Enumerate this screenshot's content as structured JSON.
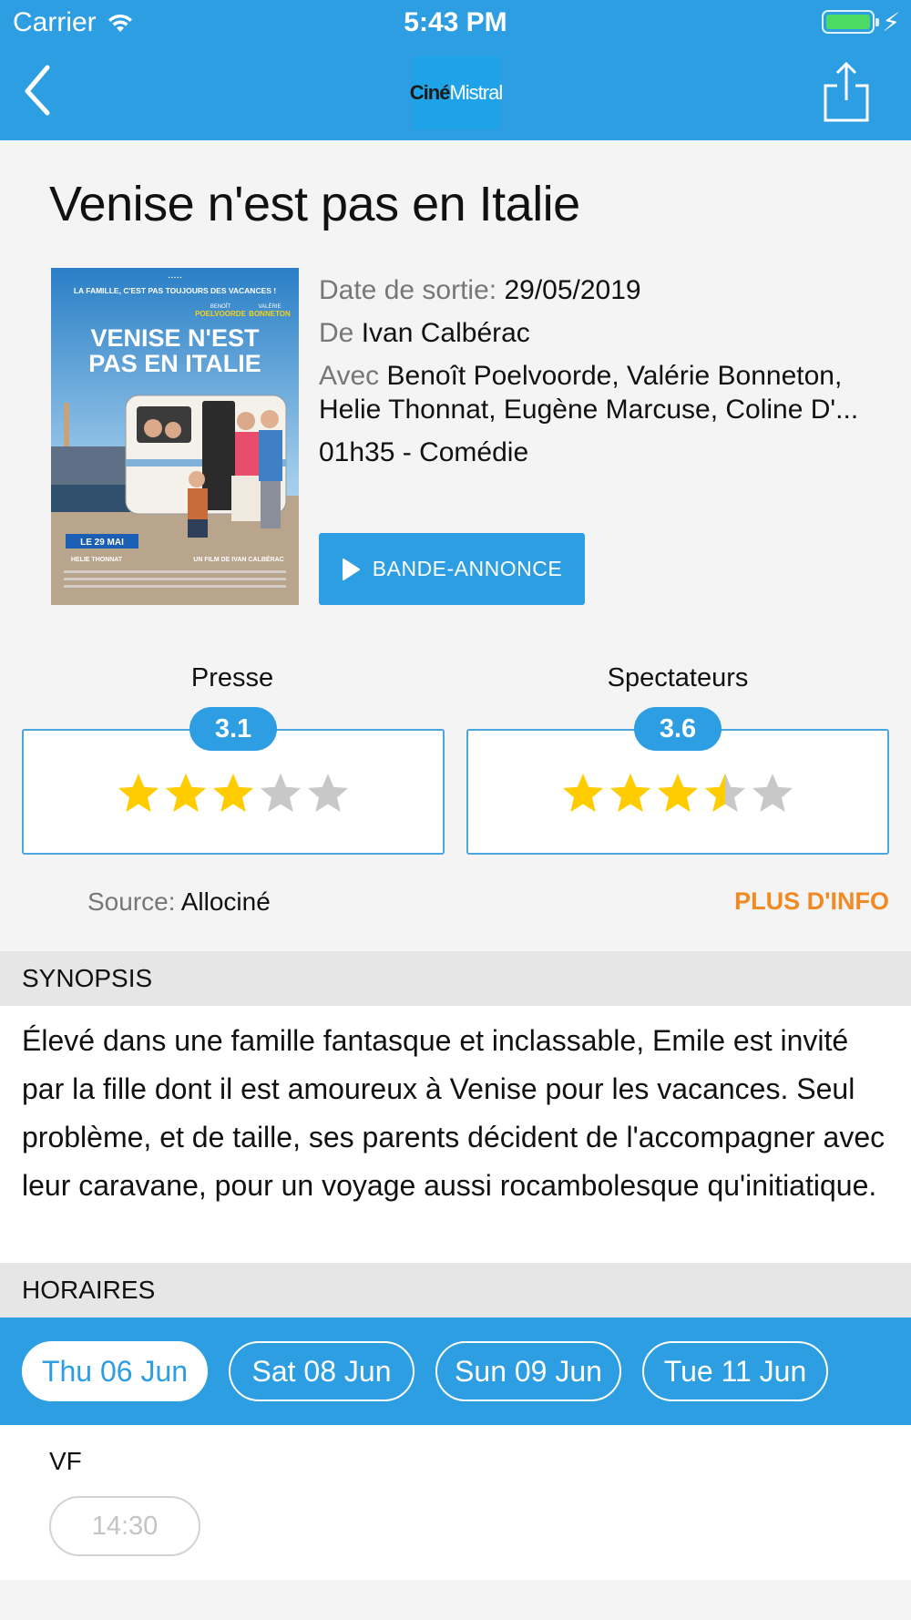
{
  "status_bar": {
    "carrier": "Carrier",
    "time": "5:43 PM"
  },
  "nav": {
    "back_icon": "chevron-left-icon",
    "logo": {
      "part1": "Ciné",
      "part2": "Mistral"
    },
    "share_icon": "share-icon"
  },
  "movie": {
    "title": "Venise n'est pas en Italie",
    "release_label": "Date de sortie:",
    "release_date": "29/05/2019",
    "director_label": "De",
    "director": "Ivan Calbérac",
    "cast_label": "Avec",
    "cast_line1": "Benoît Poelvoorde, Valérie Bonneton,",
    "cast_line2": "Helie Thonnat, Eugène Marcuse, Coline D'...",
    "duration_genre": "01h35 - Comédie",
    "trailer_label": "BANDE-ANNONCE"
  },
  "poster": {
    "tagline": "LA FAMILLE, C'EST PAS TOUJOURS DES VACANCES !",
    "actor1_first": "BENOÎT",
    "actor1_last": "POELVOORDE",
    "actor2_first": "VALÉRIE",
    "actor2_last": "BONNETON",
    "title_line1": "VENISE N'EST",
    "title_line2": "PAS EN ITALIE",
    "date_badge": "LE 29 MAI",
    "footer_actor": "HELIE THONNAT",
    "footer_director": "UN FILM DE IVAN CALBÉRAC"
  },
  "ratings": {
    "press": {
      "label": "Presse",
      "score": "3.1",
      "stars_filled": 3.1
    },
    "audience": {
      "label": "Spectateurs",
      "score": "3.6",
      "stars_filled": 3.6
    },
    "source_label": "Source:",
    "source": "Allociné",
    "more_info": "PLUS D'INFO",
    "star_color": "#ffcc00",
    "star_empty_color": "#c8c8c8"
  },
  "synopsis": {
    "header": "SYNOPSIS",
    "text": "Élevé dans une famille fantasque et inclassable, Emile est invité par la fille dont il est amoureux à Venise pour les vacances. Seul problème, et de taille, ses parents décident de l'accompagner avec leur caravane, pour un voyage aussi rocambolesque qu'initiatique."
  },
  "schedule": {
    "header": "HORAIRES",
    "dates": [
      "Thu 06 Jun",
      "Sat 08 Jun",
      "Sun 09 Jun",
      "Tue 11 Jun"
    ],
    "selected_date": "Thu 06 Jun",
    "version": "VF",
    "times": [
      "14:30"
    ]
  },
  "colors": {
    "accent": "#2d9ee2",
    "more_info": "#f08a24"
  }
}
